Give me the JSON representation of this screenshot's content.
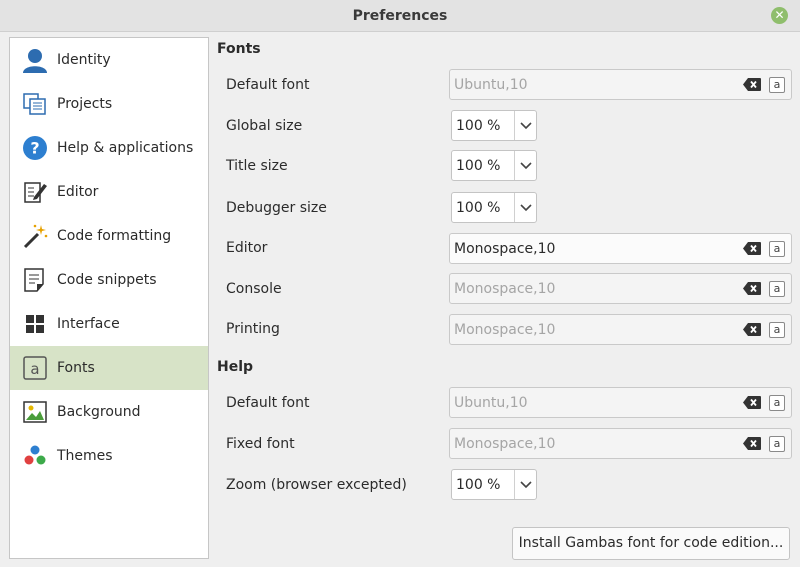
{
  "window": {
    "title": "Preferences"
  },
  "sidebar": {
    "items": [
      {
        "label": "Identity",
        "icon": "user-icon"
      },
      {
        "label": "Projects",
        "icon": "projects-icon"
      },
      {
        "label": "Help & applications",
        "icon": "help-icon"
      },
      {
        "label": "Editor",
        "icon": "editor-icon"
      },
      {
        "label": "Code formatting",
        "icon": "magic-wand-icon"
      },
      {
        "label": "Code snippets",
        "icon": "snippets-icon"
      },
      {
        "label": "Interface",
        "icon": "interface-icon"
      },
      {
        "label": "Fonts",
        "icon": "font-icon"
      },
      {
        "label": "Background",
        "icon": "image-icon"
      },
      {
        "label": "Themes",
        "icon": "themes-icon"
      }
    ],
    "selected": "Fonts"
  },
  "fonts_section": {
    "title": "Fonts",
    "default_font": {
      "label": "Default font",
      "placeholder": "Ubuntu,10"
    },
    "global_size": {
      "label": "Global size",
      "value": "100 %"
    },
    "title_size": {
      "label": "Title size",
      "value": "100 %"
    },
    "debugger_size": {
      "label": "Debugger size",
      "value": "100 %"
    },
    "editor": {
      "label": "Editor",
      "value": "Monospace,10"
    },
    "console": {
      "label": "Console",
      "placeholder": "Monospace,10"
    },
    "printing": {
      "label": "Printing",
      "placeholder": "Monospace,10"
    }
  },
  "help_section": {
    "title": "Help",
    "default_font": {
      "label": "Default font",
      "placeholder": "Ubuntu,10"
    },
    "fixed_font": {
      "label": "Fixed font",
      "placeholder": "Monospace,10"
    },
    "zoom": {
      "label": "Zoom (browser excepted)",
      "value": "100 %"
    }
  },
  "font_picker_glyph": "a",
  "install_button": {
    "label": "Install Gambas font for code edition..."
  },
  "colors": {
    "selection": "#d7e3c7",
    "close_button": "#8fbe6c",
    "placeholder_text": "#a5a5a5"
  }
}
